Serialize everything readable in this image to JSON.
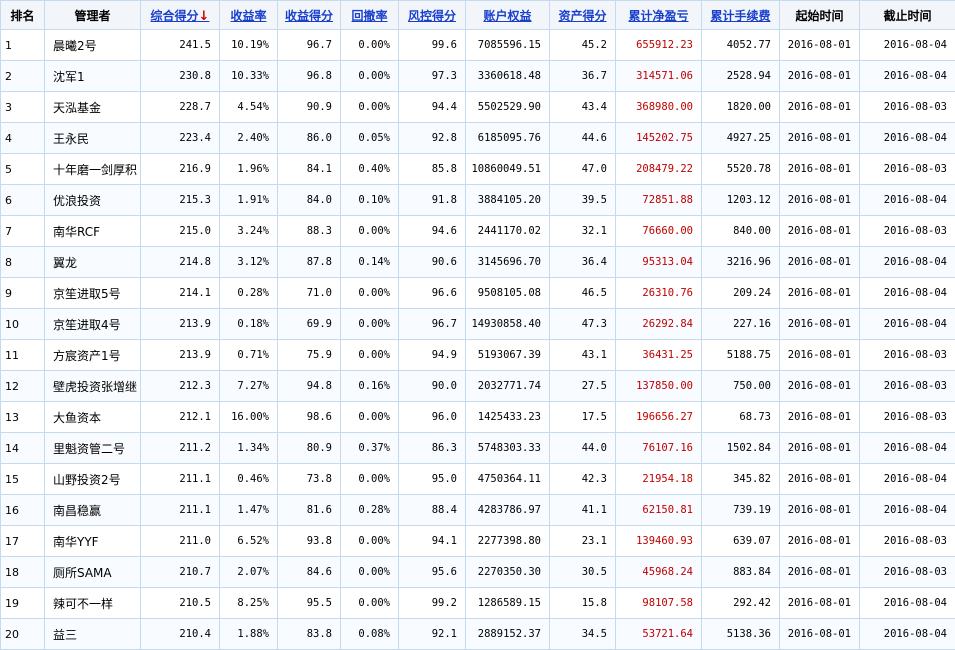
{
  "headers": {
    "rank": "排名",
    "manager": "管理者",
    "composite": "综合得分",
    "composite_arrow": "↓",
    "return_rate": "收益率",
    "return_score": "收益得分",
    "drawdown": "回撤率",
    "risk_score": "风控得分",
    "equity": "账户权益",
    "asset_score": "资产得分",
    "net_pnl": "累计净盈亏",
    "fees": "累计手续费",
    "start": "起始时间",
    "end": "截止时间"
  },
  "colors": {
    "link": "#1a3fcc",
    "pnl": "#c00000",
    "border": "#c5d9ef"
  },
  "rows": [
    {
      "rank": "1",
      "manager": "晨曦2号",
      "composite": "241.5",
      "return_rate": "10.19%",
      "return_score": "96.7",
      "drawdown": "0.00%",
      "risk_score": "99.6",
      "equity": "7085596.15",
      "asset_score": "45.2",
      "net_pnl": "655912.23",
      "fees": "4052.77",
      "start": "2016-08-01",
      "end": "2016-08-04"
    },
    {
      "rank": "2",
      "manager": "沈军1",
      "composite": "230.8",
      "return_rate": "10.33%",
      "return_score": "96.8",
      "drawdown": "0.00%",
      "risk_score": "97.3",
      "equity": "3360618.48",
      "asset_score": "36.7",
      "net_pnl": "314571.06",
      "fees": "2528.94",
      "start": "2016-08-01",
      "end": "2016-08-04"
    },
    {
      "rank": "3",
      "manager": "天泓基金",
      "composite": "228.7",
      "return_rate": "4.54%",
      "return_score": "90.9",
      "drawdown": "0.00%",
      "risk_score": "94.4",
      "equity": "5502529.90",
      "asset_score": "43.4",
      "net_pnl": "368980.00",
      "fees": "1820.00",
      "start": "2016-08-01",
      "end": "2016-08-03"
    },
    {
      "rank": "4",
      "manager": "王永民",
      "composite": "223.4",
      "return_rate": "2.40%",
      "return_score": "86.0",
      "drawdown": "0.05%",
      "risk_score": "92.8",
      "equity": "6185095.76",
      "asset_score": "44.6",
      "net_pnl": "145202.75",
      "fees": "4927.25",
      "start": "2016-08-01",
      "end": "2016-08-04"
    },
    {
      "rank": "5",
      "manager": "十年磨一剑厚积",
      "composite": "216.9",
      "return_rate": "1.96%",
      "return_score": "84.1",
      "drawdown": "0.40%",
      "risk_score": "85.8",
      "equity": "10860049.51",
      "asset_score": "47.0",
      "net_pnl": "208479.22",
      "fees": "5520.78",
      "start": "2016-08-01",
      "end": "2016-08-03"
    },
    {
      "rank": "6",
      "manager": "优浪投资",
      "composite": "215.3",
      "return_rate": "1.91%",
      "return_score": "84.0",
      "drawdown": "0.10%",
      "risk_score": "91.8",
      "equity": "3884105.20",
      "asset_score": "39.5",
      "net_pnl": "72851.88",
      "fees": "1203.12",
      "start": "2016-08-01",
      "end": "2016-08-04"
    },
    {
      "rank": "7",
      "manager": "南华RCF",
      "composite": "215.0",
      "return_rate": "3.24%",
      "return_score": "88.3",
      "drawdown": "0.00%",
      "risk_score": "94.6",
      "equity": "2441170.02",
      "asset_score": "32.1",
      "net_pnl": "76660.00",
      "fees": "840.00",
      "start": "2016-08-01",
      "end": "2016-08-03"
    },
    {
      "rank": "8",
      "manager": "翼龙",
      "composite": "214.8",
      "return_rate": "3.12%",
      "return_score": "87.8",
      "drawdown": "0.14%",
      "risk_score": "90.6",
      "equity": "3145696.70",
      "asset_score": "36.4",
      "net_pnl": "95313.04",
      "fees": "3216.96",
      "start": "2016-08-01",
      "end": "2016-08-04"
    },
    {
      "rank": "9",
      "manager": "京笙进取5号",
      "composite": "214.1",
      "return_rate": "0.28%",
      "return_score": "71.0",
      "drawdown": "0.00%",
      "risk_score": "96.6",
      "equity": "9508105.08",
      "asset_score": "46.5",
      "net_pnl": "26310.76",
      "fees": "209.24",
      "start": "2016-08-01",
      "end": "2016-08-04"
    },
    {
      "rank": "10",
      "manager": "京笙进取4号",
      "composite": "213.9",
      "return_rate": "0.18%",
      "return_score": "69.9",
      "drawdown": "0.00%",
      "risk_score": "96.7",
      "equity": "14930858.40",
      "asset_score": "47.3",
      "net_pnl": "26292.84",
      "fees": "227.16",
      "start": "2016-08-01",
      "end": "2016-08-04"
    },
    {
      "rank": "11",
      "manager": "方宸资产1号",
      "composite": "213.9",
      "return_rate": "0.71%",
      "return_score": "75.9",
      "drawdown": "0.00%",
      "risk_score": "94.9",
      "equity": "5193067.39",
      "asset_score": "43.1",
      "net_pnl": "36431.25",
      "fees": "5188.75",
      "start": "2016-08-01",
      "end": "2016-08-03"
    },
    {
      "rank": "12",
      "manager": "壁虎投资张增继",
      "composite": "212.3",
      "return_rate": "7.27%",
      "return_score": "94.8",
      "drawdown": "0.16%",
      "risk_score": "90.0",
      "equity": "2032771.74",
      "asset_score": "27.5",
      "net_pnl": "137850.00",
      "fees": "750.00",
      "start": "2016-08-01",
      "end": "2016-08-03"
    },
    {
      "rank": "13",
      "manager": "大鱼资本",
      "composite": "212.1",
      "return_rate": "16.00%",
      "return_score": "98.6",
      "drawdown": "0.00%",
      "risk_score": "96.0",
      "equity": "1425433.23",
      "asset_score": "17.5",
      "net_pnl": "196656.27",
      "fees": "68.73",
      "start": "2016-08-01",
      "end": "2016-08-03"
    },
    {
      "rank": "14",
      "manager": "里魁资管二号",
      "composite": "211.2",
      "return_rate": "1.34%",
      "return_score": "80.9",
      "drawdown": "0.37%",
      "risk_score": "86.3",
      "equity": "5748303.33",
      "asset_score": "44.0",
      "net_pnl": "76107.16",
      "fees": "1502.84",
      "start": "2016-08-01",
      "end": "2016-08-04"
    },
    {
      "rank": "15",
      "manager": "山野投资2号",
      "composite": "211.1",
      "return_rate": "0.46%",
      "return_score": "73.8",
      "drawdown": "0.00%",
      "risk_score": "95.0",
      "equity": "4750364.11",
      "asset_score": "42.3",
      "net_pnl": "21954.18",
      "fees": "345.82",
      "start": "2016-08-01",
      "end": "2016-08-04"
    },
    {
      "rank": "16",
      "manager": "南昌稳赢",
      "composite": "211.1",
      "return_rate": "1.47%",
      "return_score": "81.6",
      "drawdown": "0.28%",
      "risk_score": "88.4",
      "equity": "4283786.97",
      "asset_score": "41.1",
      "net_pnl": "62150.81",
      "fees": "739.19",
      "start": "2016-08-01",
      "end": "2016-08-04"
    },
    {
      "rank": "17",
      "manager": "南华YYF",
      "composite": "211.0",
      "return_rate": "6.52%",
      "return_score": "93.8",
      "drawdown": "0.00%",
      "risk_score": "94.1",
      "equity": "2277398.80",
      "asset_score": "23.1",
      "net_pnl": "139460.93",
      "fees": "639.07",
      "start": "2016-08-01",
      "end": "2016-08-03"
    },
    {
      "rank": "18",
      "manager": "厕所SAMA",
      "composite": "210.7",
      "return_rate": "2.07%",
      "return_score": "84.6",
      "drawdown": "0.00%",
      "risk_score": "95.6",
      "equity": "2270350.30",
      "asset_score": "30.5",
      "net_pnl": "45968.24",
      "fees": "883.84",
      "start": "2016-08-01",
      "end": "2016-08-03"
    },
    {
      "rank": "19",
      "manager": "辣可不一样",
      "composite": "210.5",
      "return_rate": "8.25%",
      "return_score": "95.5",
      "drawdown": "0.00%",
      "risk_score": "99.2",
      "equity": "1286589.15",
      "asset_score": "15.8",
      "net_pnl": "98107.58",
      "fees": "292.42",
      "start": "2016-08-01",
      "end": "2016-08-04"
    },
    {
      "rank": "20",
      "manager": "益三",
      "composite": "210.4",
      "return_rate": "1.88%",
      "return_score": "83.8",
      "drawdown": "0.08%",
      "risk_score": "92.1",
      "equity": "2889152.37",
      "asset_score": "34.5",
      "net_pnl": "53721.64",
      "fees": "5138.36",
      "start": "2016-08-01",
      "end": "2016-08-04"
    }
  ]
}
